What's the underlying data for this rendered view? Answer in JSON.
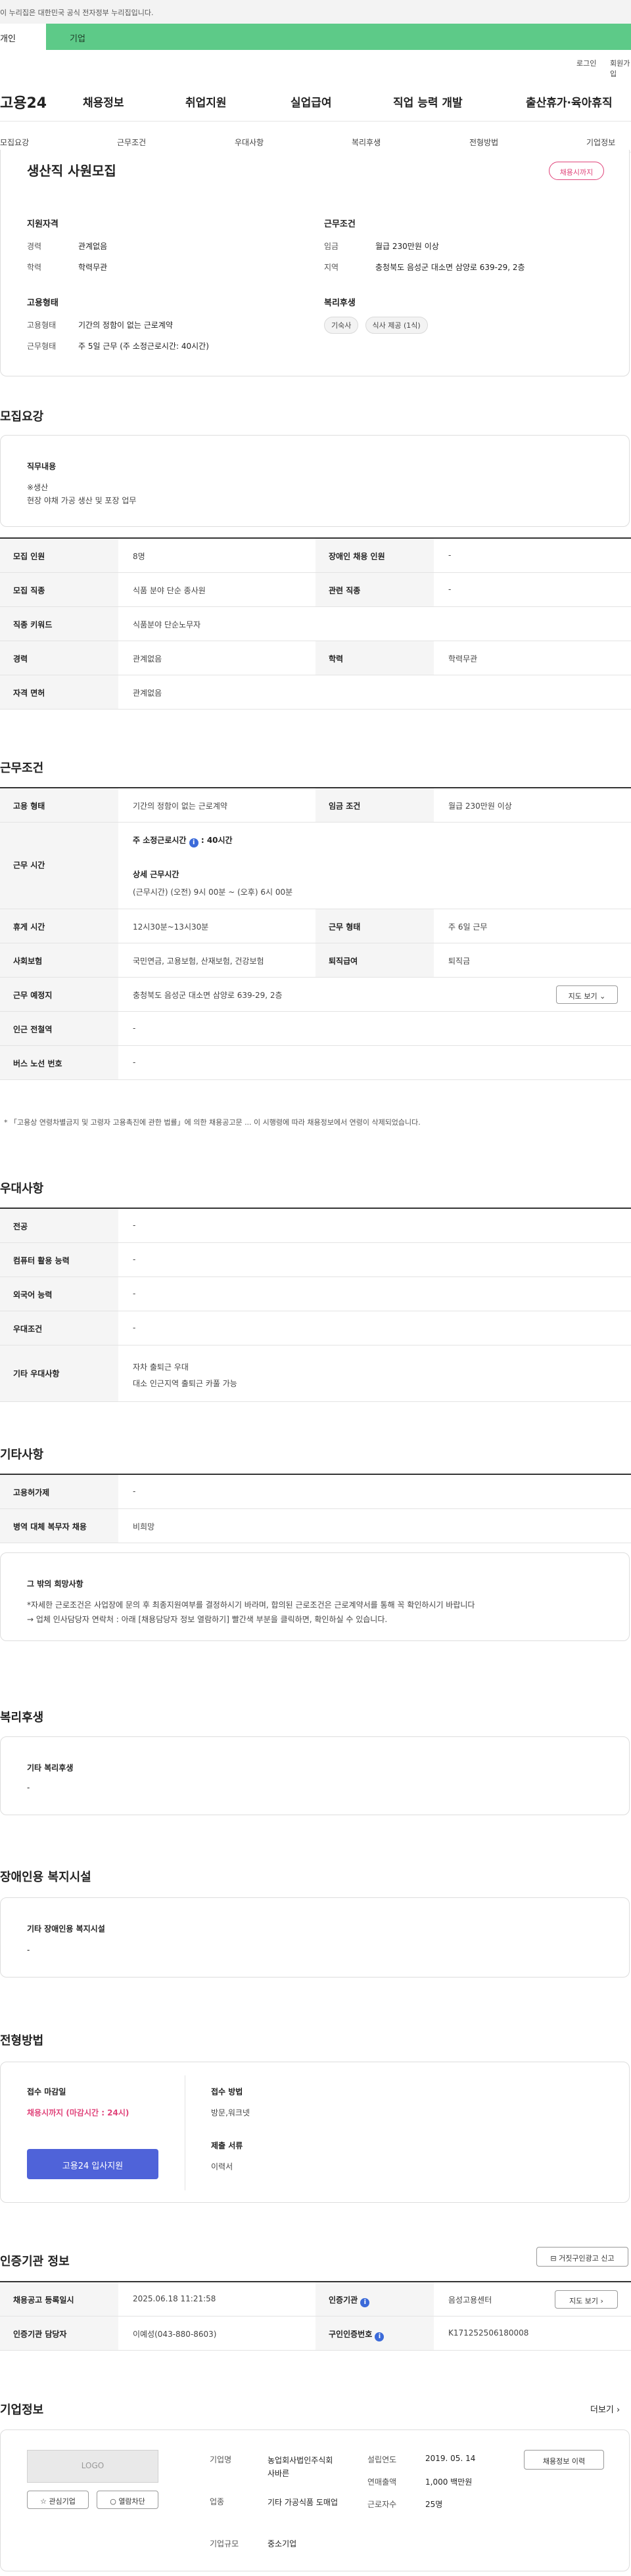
{
  "banner": "이 누리집은 대한민국 공식 전자정부 누리집입니다.",
  "top_tabs": [
    "개인",
    "기업"
  ],
  "util": [
    "로그인",
    "회원가입"
  ],
  "gnb": {
    "logo": "고용24",
    "menu": [
      "채용정보",
      "취업지원",
      "실업급여",
      "직업 능력 개발",
      "출산휴가·육아휴직"
    ]
  },
  "subnav": [
    "모집요강",
    "근무조건",
    "우대사항",
    "복리후생",
    "전형방법",
    "기업정보"
  ],
  "summary": {
    "title": "생산직 사원모집",
    "badge": "채용시까지",
    "qualify_title": "지원자격",
    "qualify": [
      {
        "k": "경력",
        "v": "관계없음"
      },
      {
        "k": "학력",
        "v": "학력무관"
      }
    ],
    "work_title": "근무조건",
    "work": [
      {
        "k": "임금",
        "v": "월급 230만원 이상"
      },
      {
        "k": "지역",
        "v": "충청북도 음성군 대소면 삼양로 639-29, 2층"
      }
    ],
    "employ_title": "고용형태",
    "employ": [
      {
        "k": "고용형태",
        "v": "기간의 정함이 없는 근로계약"
      },
      {
        "k": "근무형태",
        "v": "주 5일 근무 (주 소정근로시간: 40시간)"
      }
    ],
    "welfare_title": "복리후생",
    "welfare": [
      "기숙사",
      "식사 제공 (1식)"
    ]
  },
  "recruit": {
    "title": "모집요강",
    "job_title": "직무내용",
    "job_lines": [
      "※생산",
      "현장 야채 가공 생산 및 포장 업무"
    ],
    "rows": [
      {
        "k1": "모집 인원",
        "v1": "8명",
        "k2": "장애인 채용 인원",
        "v2": "-"
      },
      {
        "k1": "모집 직종",
        "v1": "식품 분야 단순 종사원",
        "k2": "관련 직종",
        "v2": "-"
      },
      {
        "k1": "직종 키워드",
        "v1": "식품분야 단순노무자"
      },
      {
        "k1": "경력",
        "v1": "관계없음",
        "k2": "학력",
        "v2": "학력무관"
      },
      {
        "k1": "자격 면허",
        "v1": "관계없음"
      }
    ]
  },
  "conditions": {
    "title": "근무조건",
    "employ_type_k": "고용 형태",
    "employ_type_v": "기간의 정함이 없는 근로계약",
    "wage_k": "임금 조건",
    "wage_v": "월급 230만원 이상",
    "hours_k": "근무 시간",
    "hours_weekly_label": "주 소정근로시간",
    "hours_weekly_value": ": 40시간",
    "hours_detail_label": "상세 근무시간",
    "hours_detail_value": "(근무시간) (오전) 9시 00분 ~ (오후) 6시 00분",
    "rest_k": "휴게 시간",
    "rest_v": "12시30분~13시30분",
    "form_k": "근무 형태",
    "form_v": "주 6일 근무",
    "insurance_k": "사회보험",
    "insurance_v": "국민연금, 고용보험, 산재보험, 건강보험",
    "retire_k": "퇴직급여",
    "retire_v": "퇴직금",
    "place_k": "근무 예정지",
    "place_v": "충청북도 음성군 대소면 삼양로 639-29, 2층",
    "map_btn": "지도 보기",
    "subway_k": "인근 전철역",
    "subway_v": "-",
    "bus_k": "버스 노선 번호",
    "bus_v": "-",
    "note": "* 「고용상 연령차별금지 및 고령자 고용촉진에 관한 법률」에 의한 채용공고문 ... 이 시행령에 따라 채용정보에서 연령이 삭제되었습니다."
  },
  "preferences": {
    "title": "우대사항",
    "rows": [
      {
        "k": "전공",
        "v": "-"
      },
      {
        "k": "컴퓨터 활용 능력",
        "v": "-"
      },
      {
        "k": "외국어 능력",
        "v": "-"
      },
      {
        "k": "우대조건",
        "v": "-"
      }
    ],
    "etc_k": "기타 우대사항",
    "etc_lines": [
      "자차 출퇴근 우대",
      "대소 인근지역 출퇴근 카풀 가능"
    ]
  },
  "etc": {
    "title": "기타사항",
    "rows": [
      {
        "k": "고용허가제",
        "v": "-"
      },
      {
        "k": "병역 대체 복무자 채용",
        "v": "비희망"
      }
    ],
    "other_title": "그 밖의 희망사항",
    "other_lines": [
      "*자세한 근로조건은 사업장에 문의 후 최종지원여부를 결정하시기 바라며, 합의된 근로조건은 근로계약서를 통해 꼭 확인하시기 바랍니다",
      "→ 업체 인사담당자 연락처 : 아래 [채용담당자 정보 열람하기] 빨간색 부분을 클릭하면, 확인하실 수 있습니다."
    ]
  },
  "welfare": {
    "title": "복리후생",
    "box_title": "기타 복리후생",
    "box_value": "-"
  },
  "disability": {
    "title": "장애인용 복지시설",
    "box_title": "기타 장애인용 복지시설",
    "box_value": "-"
  },
  "selection": {
    "title": "전형방법",
    "deadline_title": "접수 마감일",
    "deadline_value": "채용시까지 (마감시간 : 24시)",
    "apply_btn": "고용24 입사지원",
    "method_title": "접수 방법",
    "method_value": "방문,워크넷",
    "docs_title": "제출 서류",
    "docs_value": "이력서"
  },
  "cert": {
    "title": "인증기관 정보",
    "report_btn": "거짓구인광고 신고",
    "rows": [
      {
        "k1": "채용공고 등록일시",
        "v1": "2025.06.18 11:21:58",
        "k2": "인증기관",
        "v2": "음성고용센터"
      },
      {
        "k1": "인증기관 담당자",
        "v1": "이예성(043-880-8603)",
        "k2": "구인인증번호",
        "v2": "K171252506180008"
      }
    ],
    "map_btn": "지도 보기"
  },
  "company": {
    "title": "기업정보",
    "more": "더보기",
    "logo": "LOGO",
    "fav_btn": "관심기업",
    "block_btn": "열람차단",
    "fields": [
      {
        "k": "기업명",
        "v": "농업회사법인주식회사바른"
      },
      {
        "k": "업종",
        "v": "기타 가공식품 도매업"
      },
      {
        "k": "기업규모",
        "v": "중소기업"
      }
    ],
    "fields2": [
      {
        "k": "설립연도",
        "v": "2019. 05. 14"
      },
      {
        "k": "연매출액",
        "v": "1,000 백만원"
      },
      {
        "k": "근로자수",
        "v": "25명"
      }
    ],
    "jobs_btn": "채용정보 이력"
  }
}
